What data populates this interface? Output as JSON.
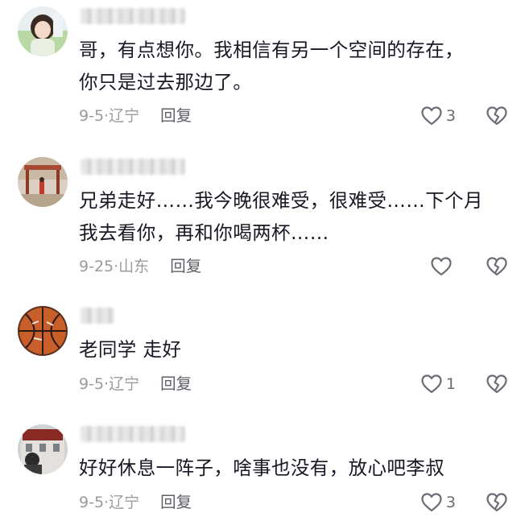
{
  "comments": [
    {
      "username": "",
      "text": "哥，有点想你。我相信有另一个空间的存在，\n你只是过去那边了。",
      "date": "9-5",
      "location": "辽宁",
      "reply_label": "回复",
      "likes": "3"
    },
    {
      "username": "",
      "text": "兄弟走好……我今晚很难受，很难受……下个月\n我去看你，再和你喝两杯……",
      "date": "9-25",
      "location": "山东",
      "reply_label": "回复",
      "likes": ""
    },
    {
      "username": "",
      "text": "老同学 走好",
      "date": "9-5",
      "location": "辽宁",
      "reply_label": "回复",
      "likes": "1"
    },
    {
      "username": "",
      "text": "好好休息一阵子，啥事也没有，放心吧李叔",
      "date": "9-5",
      "location": "辽宁",
      "reply_label": "回复",
      "likes": "3"
    }
  ],
  "separator": "·",
  "icons": {
    "like": "heart-outline-icon",
    "dislike": "broken-heart-icon"
  },
  "colors": {
    "text": "#161823",
    "meta": "#9a9ba0",
    "icon": "#6b6d75"
  }
}
